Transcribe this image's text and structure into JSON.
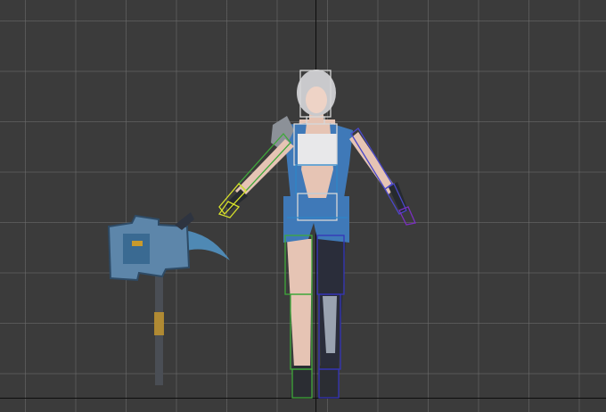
{
  "viewport": {
    "grid_color": "#6e6e6e",
    "background_color": "#3b3b3b",
    "axis_color": "#0d0d0d"
  },
  "scene": {
    "character": {
      "hair_color": "#c9c9cc",
      "outfit_color": "#3f79b8",
      "skin_color": "#e6c4b4"
    },
    "weapon": {
      "head_color": "#5d86aa",
      "blade_color": "#4f89b4",
      "accent_color": "#c99a2c"
    },
    "bone_colors": {
      "head": "#d8d8d8",
      "spine": "#d8d8d8",
      "pelvis": "#2d86c8",
      "left_arm": "#3fa83a",
      "left_hand": "#d6e02a",
      "right_arm": "#4a48c8",
      "right_hand": "#7a2fc0",
      "left_leg": "#3fa83a",
      "right_leg": "#3535b8"
    }
  }
}
